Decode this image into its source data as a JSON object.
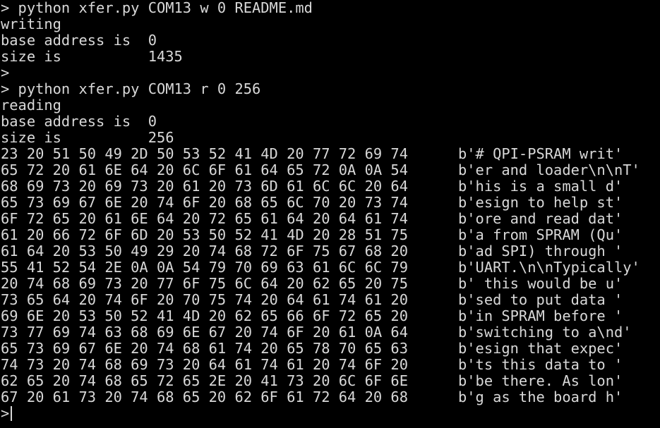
{
  "session": {
    "cmd1": "> python xfer.py COM13 w 0 README.md",
    "cmd1_out": [
      "writing",
      "base address is  0",
      "size is          1435",
      ">"
    ],
    "cmd2": "> python xfer.py COM13 r 0 256",
    "cmd2_out": [
      "reading",
      "base address is  0",
      "size is          256"
    ],
    "dump": [
      {
        "hex": "23 20 51 50 49 2D 50 53 52 41 4D 20 77 72 69 74",
        "ascii": "b'# QPI-PSRAM writ'"
      },
      {
        "hex": "65 72 20 61 6E 64 20 6C 6F 61 64 65 72 0A 0A 54",
        "ascii": "b'er and loader\\n\\nT'"
      },
      {
        "hex": "68 69 73 20 69 73 20 61 20 73 6D 61 6C 6C 20 64",
        "ascii": "b'his is a small d'"
      },
      {
        "hex": "65 73 69 67 6E 20 74 6F 20 68 65 6C 70 20 73 74",
        "ascii": "b'esign to help st'"
      },
      {
        "hex": "6F 72 65 20 61 6E 64 20 72 65 61 64 20 64 61 74",
        "ascii": "b'ore and read dat'"
      },
      {
        "hex": "61 20 66 72 6F 6D 20 53 50 52 41 4D 20 28 51 75",
        "ascii": "b'a from SPRAM (Qu'"
      },
      {
        "hex": "61 64 20 53 50 49 29 20 74 68 72 6F 75 67 68 20",
        "ascii": "b'ad SPI) through '"
      },
      {
        "hex": "55 41 52 54 2E 0A 0A 54 79 70 69 63 61 6C 6C 79",
        "ascii": "b'UART.\\n\\nTypically'"
      },
      {
        "hex": "20 74 68 69 73 20 77 6F 75 6C 64 20 62 65 20 75",
        "ascii": "b' this would be u'"
      },
      {
        "hex": "73 65 64 20 74 6F 20 70 75 74 20 64 61 74 61 20",
        "ascii": "b'sed to put data '"
      },
      {
        "hex": "69 6E 20 53 50 52 41 4D 20 62 65 66 6F 72 65 20",
        "ascii": "b'in SPRAM before '"
      },
      {
        "hex": "73 77 69 74 63 68 69 6E 67 20 74 6F 20 61 0A 64",
        "ascii": "b'switching to a\\nd'"
      },
      {
        "hex": "65 73 69 67 6E 20 74 68 61 74 20 65 78 70 65 63",
        "ascii": "b'esign that expec'"
      },
      {
        "hex": "74 73 20 74 68 69 73 20 64 61 74 61 20 74 6F 20",
        "ascii": "b'ts this data to '"
      },
      {
        "hex": "62 65 20 74 68 65 72 65 2E 20 41 73 20 6C 6F 6E",
        "ascii": "b'be there. As lon'"
      },
      {
        "hex": "67 20 61 73 20 74 68 65 20 62 6F 61 72 64 20 68",
        "ascii": "b'g as the board h'"
      }
    ],
    "final_prompt": ">"
  },
  "colors": {
    "background": "#000000",
    "foreground": "#d8d8d8"
  }
}
